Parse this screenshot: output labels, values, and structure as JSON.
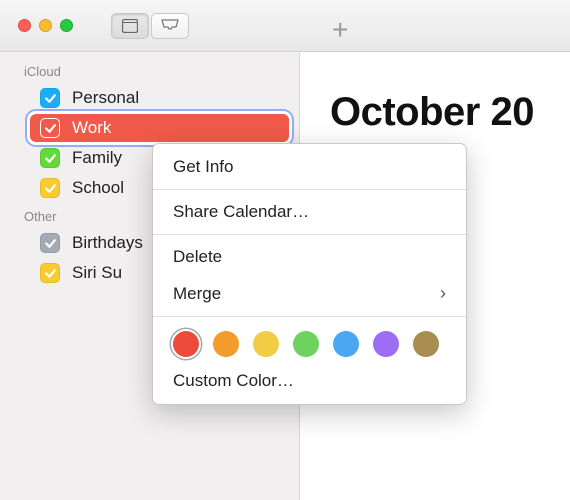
{
  "month_title": "October 20",
  "sidebar": {
    "sections": [
      {
        "header": "iCloud",
        "items": [
          {
            "label": "Personal",
            "color": "#1badf8",
            "selected": false
          },
          {
            "label": "Work",
            "color": "#f15a4a",
            "selected": true
          },
          {
            "label": "Family",
            "color": "#63da38",
            "selected": false
          },
          {
            "label": "School",
            "color": "#f8cc2f",
            "selected": false
          }
        ]
      },
      {
        "header": "Other",
        "items": [
          {
            "label": "Birthdays",
            "color": "#a2aab3",
            "selected": false
          },
          {
            "label": "Siri Su",
            "color": "#f8cc2f",
            "selected": false
          }
        ]
      }
    ]
  },
  "context_menu": {
    "get_info": "Get Info",
    "share": "Share Calendar…",
    "delete": "Delete",
    "merge": "Merge",
    "custom_color": "Custom Color…",
    "colors": [
      {
        "hex": "#ec4b3a",
        "selected": true
      },
      {
        "hex": "#f39c2b",
        "selected": false
      },
      {
        "hex": "#f3cc46",
        "selected": false
      },
      {
        "hex": "#6dd35e",
        "selected": false
      },
      {
        "hex": "#4aa8f0",
        "selected": false
      },
      {
        "hex": "#9b6ef3",
        "selected": false
      },
      {
        "hex": "#a98c4f",
        "selected": false
      }
    ]
  }
}
